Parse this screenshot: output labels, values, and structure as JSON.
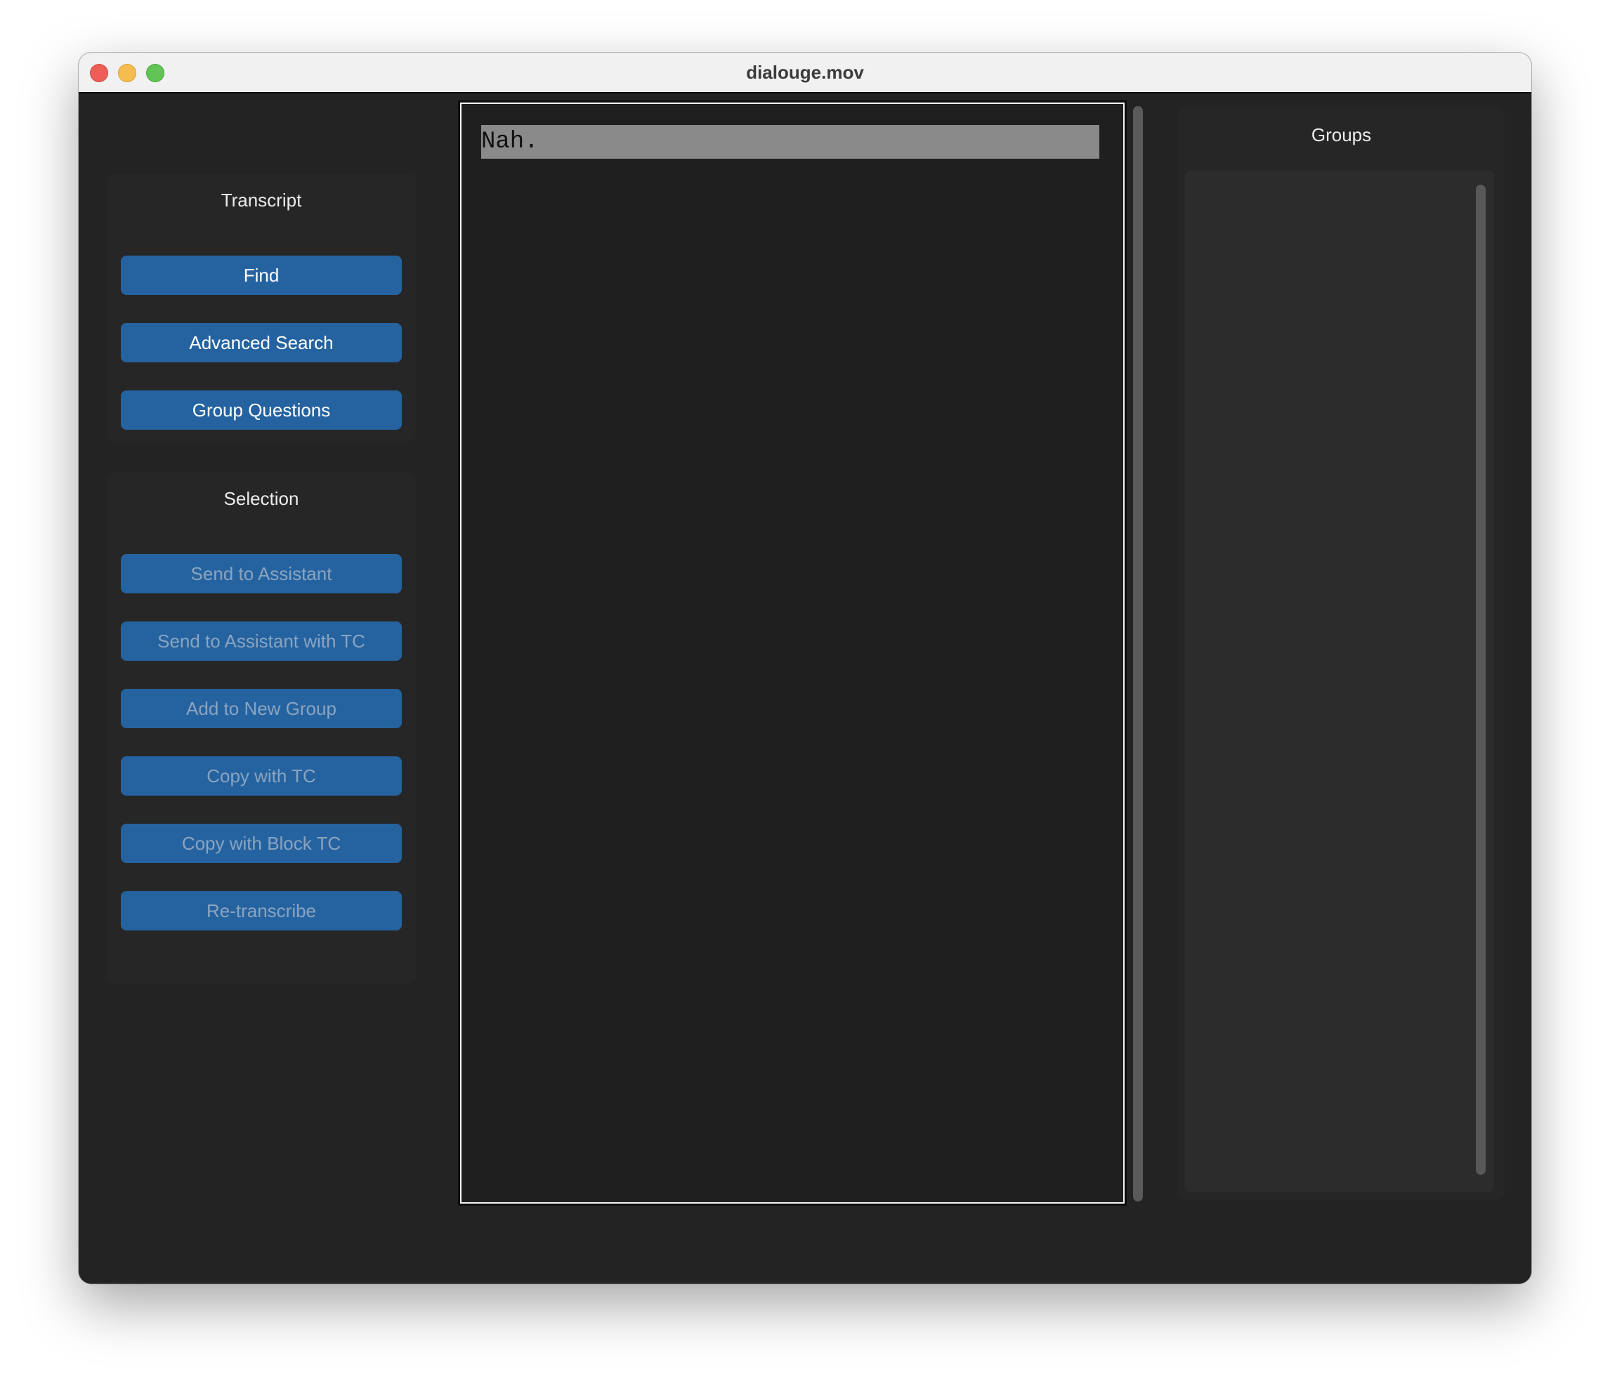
{
  "window": {
    "title": "dialouge.mov"
  },
  "transcript_panel": {
    "title": "Transcript",
    "buttons": [
      {
        "label": "Find",
        "enabled": true
      },
      {
        "label": "Advanced Search",
        "enabled": true
      },
      {
        "label": "Group Questions",
        "enabled": true
      }
    ]
  },
  "selection_panel": {
    "title": "Selection",
    "buttons": [
      {
        "label": "Send to Assistant",
        "enabled": false
      },
      {
        "label": "Send to Assistant with TC",
        "enabled": false
      },
      {
        "label": "Add to New Group",
        "enabled": false
      },
      {
        "label": "Copy with TC",
        "enabled": false
      },
      {
        "label": "Copy with Block TC",
        "enabled": false
      },
      {
        "label": "Re-transcribe",
        "enabled": false
      }
    ]
  },
  "transcript": {
    "lines": [
      "Nah."
    ]
  },
  "groups_panel": {
    "title": "Groups",
    "items": []
  },
  "colors": {
    "button_bg": "#2563a0",
    "window_bg": "#232323",
    "panel_bg": "#262626",
    "highlight": "#8a8a8a"
  }
}
